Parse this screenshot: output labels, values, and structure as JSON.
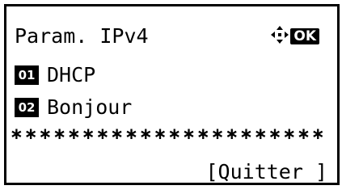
{
  "screen": {
    "title": "Param. IPv4",
    "ok_label": "OK",
    "nav_icon": "four-way-arrow-icon"
  },
  "menu": {
    "items": [
      {
        "number": "01",
        "label": "DHCP"
      },
      {
        "number": "02",
        "label": "Bonjour"
      }
    ]
  },
  "divider": "∗∗∗∗∗∗∗∗∗∗∗∗∗∗∗∗∗∗∗∗∗∗",
  "softkey": {
    "right_label": "[Quitter ]"
  }
}
